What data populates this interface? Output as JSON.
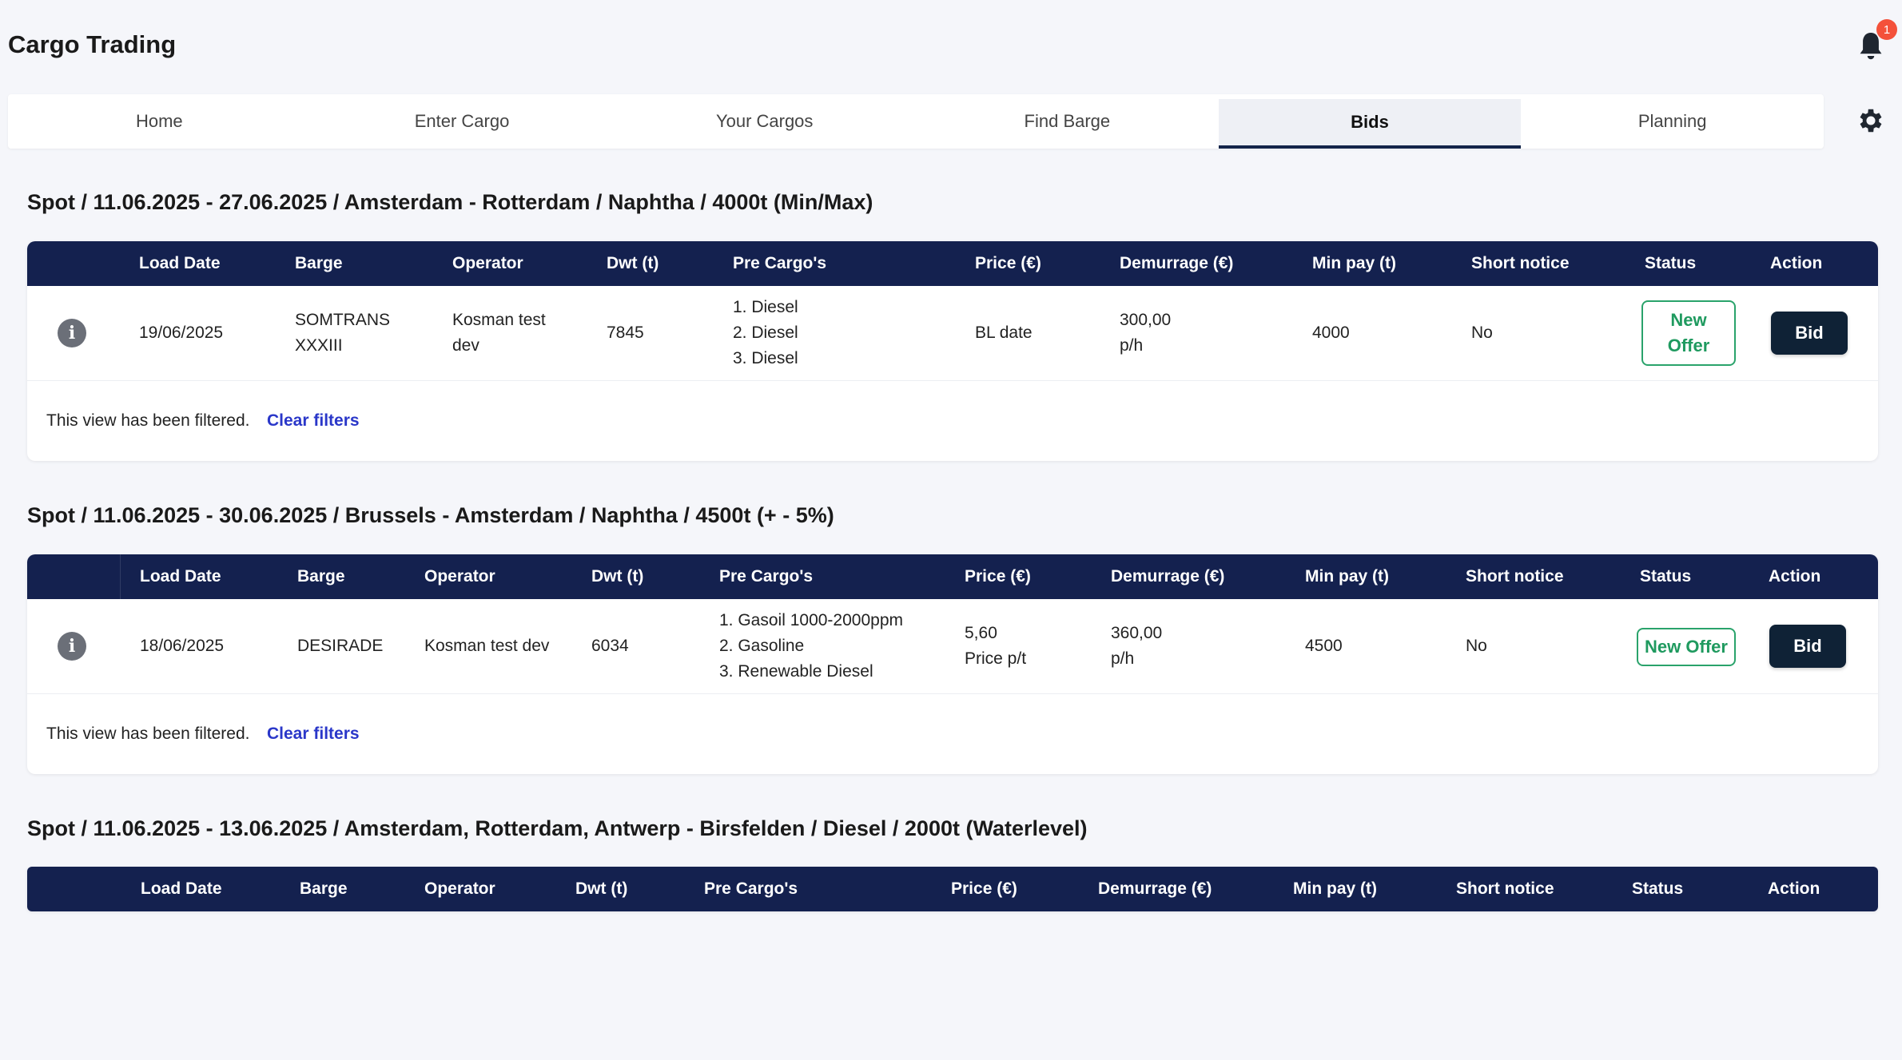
{
  "app": {
    "title": "Cargo Trading",
    "notification_count": "1"
  },
  "tabs": [
    {
      "label": "Home"
    },
    {
      "label": "Enter Cargo"
    },
    {
      "label": "Your Cargos"
    },
    {
      "label": "Find Barge"
    },
    {
      "label": "Bids",
      "active": true
    },
    {
      "label": "Planning"
    }
  ],
  "columns": [
    "Load Date",
    "Barge",
    "Operator",
    "Dwt (t)",
    "Pre Cargo's",
    "Price (€)",
    "Demurrage (€)",
    "Min pay (t)",
    "Short notice",
    "Status",
    "Action"
  ],
  "sections": [
    {
      "title": "Spot / 11.06.2025 - 27.06.2025 / Amsterdam - Rotterdam / Naphtha / 4000t (Min/Max)",
      "rows": [
        {
          "load_date": "19/06/2025",
          "barge_line1": "SOMTRANS",
          "barge_line2": "XXXIII",
          "operator_line1": "Kosman test",
          "operator_line2": "dev",
          "dwt": "7845",
          "pre_cargo": [
            "1. Diesel",
            "2. Diesel",
            "3. Diesel"
          ],
          "price_line1": "BL date",
          "price_line2": "",
          "demurrage_line1": "300,00",
          "demurrage_line2": "p/h",
          "min_pay": "4000",
          "short_notice": "No",
          "status_line1": "New",
          "status_line2": "Offer",
          "action": "Bid"
        }
      ],
      "filter_text": "This view has been filtered.",
      "clear_filters": "Clear filters"
    },
    {
      "title": "Spot / 11.06.2025 - 30.06.2025 / Brussels - Amsterdam / Naphtha / 4500t (+ - 5%)",
      "rows": [
        {
          "load_date": "18/06/2025",
          "barge": "DESIRADE",
          "operator": "Kosman test dev",
          "dwt": "6034",
          "pre_cargo": [
            "1. Gasoil 1000-2000ppm",
            "2. Gasoline",
            "3. Renewable Diesel"
          ],
          "price_line1": "5,60",
          "price_line2": "Price p/t",
          "demurrage_line1": "360,00",
          "demurrage_line2": "p/h",
          "min_pay": "4500",
          "short_notice": "No",
          "status": "New Offer",
          "action": "Bid"
        }
      ],
      "filter_text": "This view has been filtered.",
      "clear_filters": "Clear filters"
    },
    {
      "title": "Spot / 11.06.2025 - 13.06.2025 / Amsterdam, Rotterdam, Antwerp - Birsfelden / Diesel / 2000t (Waterlevel)",
      "rows": []
    }
  ]
}
